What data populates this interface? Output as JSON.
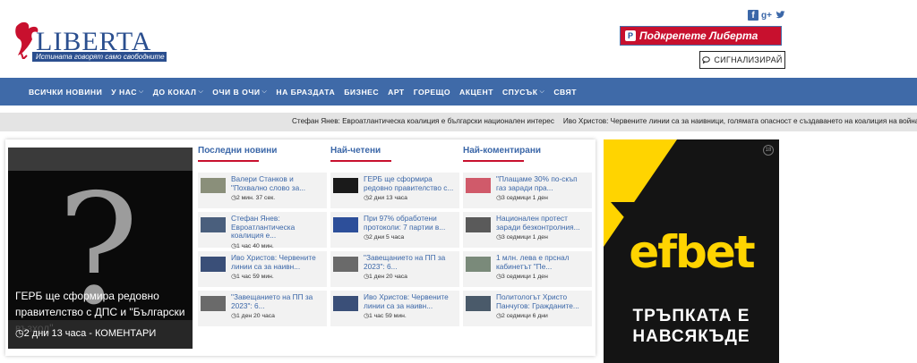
{
  "header": {
    "logo_text": "LIBERTA",
    "tagline": "Истината говорят само свободните",
    "support_label": "Подкрепете Либерта",
    "signal_label": "СИГНАЛИЗИРАЙ",
    "social": [
      "f",
      "g+",
      "t"
    ]
  },
  "nav": {
    "items": [
      {
        "label": "ВСИЧКИ НОВИНИ",
        "dropdown": false
      },
      {
        "label": "У НАС",
        "dropdown": true
      },
      {
        "label": "ДО КОКАЛ",
        "dropdown": true
      },
      {
        "label": "ОЧИ В ОЧИ",
        "dropdown": true
      },
      {
        "label": "НА БРАЗДАТА",
        "dropdown": false
      },
      {
        "label": "БИЗНЕС",
        "dropdown": false
      },
      {
        "label": "АРТ",
        "dropdown": false
      },
      {
        "label": "ГОРЕЩО",
        "dropdown": false
      },
      {
        "label": "АКЦЕНТ",
        "dropdown": false
      },
      {
        "label": "СПУСЪК",
        "dropdown": true
      },
      {
        "label": "СВЯТ",
        "dropdown": false
      }
    ]
  },
  "ticker": {
    "items": [
      "Стефан Янев: Евроатлантическа коалиция е български национален интерес",
      "Иво Христов: Червените линии са за наивници, голямата опасност е създаването на коалиция на войната"
    ]
  },
  "feature": {
    "title": "ГЕРБ ще сформира редовно правителство с ДПС и \"Български възход\"",
    "meta": "2 дни 13 часа - КОМЕНТАРИ"
  },
  "columns": [
    {
      "heading": "Последни новини",
      "items": [
        {
          "title": "Валери Станков и \"Похвално слово за...",
          "meta": "2 мин. 37 сек.",
          "thumb": "#8a8f7a"
        },
        {
          "title": "Стефан Янев: Евроатлантическа коалиция е...",
          "meta": "1 час 40 мин.",
          "thumb": "#4a5f7d"
        },
        {
          "title": "Иво Христов: Червените линии са за наивн...",
          "meta": "1 час 59 мин.",
          "thumb": "#3a4f78"
        },
        {
          "title": "\"Завещанието на ПП за 2023\": 6...",
          "meta": "1 ден 20 часа",
          "thumb": "#6a6a6a"
        }
      ]
    },
    {
      "heading": "Най-четени",
      "items": [
        {
          "title": "ГЕРБ ще сформира редовно правителство с...",
          "meta": "2 дни 13 часа",
          "thumb": "#1a1a1a"
        },
        {
          "title": "При 97% обработени протоколи: 7 партии в...",
          "meta": "2 дни 5 часа",
          "thumb": "#2d4f9a"
        },
        {
          "title": "\"Завещанието на ПП за 2023\": 6...",
          "meta": "1 ден 20 часа",
          "thumb": "#6a6a6a"
        },
        {
          "title": "Иво Христов: Червените линии са за наивн...",
          "meta": "1 час 59 мин.",
          "thumb": "#3a4f78"
        }
      ]
    },
    {
      "heading": "Най-коментирани",
      "items": [
        {
          "title": "\"Плащаме 30% по-скъп газ заради пра...",
          "meta": "3 седмици 1 ден",
          "thumb": "#d05a6a"
        },
        {
          "title": "Национален протест заради безконтролния...",
          "meta": "3 седмици 1 ден",
          "thumb": "#5a5a5a"
        },
        {
          "title": "1 млн. лева е прснал кабинетът \"Пе...",
          "meta": "3 седмици 1 ден",
          "thumb": "#7a8a7a"
        },
        {
          "title": "Политологът Христо Панчугов: Гражданите...",
          "meta": "2 седмици 6 дни",
          "thumb": "#4a5a6a"
        }
      ]
    }
  ],
  "ad": {
    "age_badge": "18",
    "brand": "efbet",
    "slogan": "ТРЪПКАТА Е НАВСЯКЪДЕ",
    "colors": {
      "background": "#141414",
      "accent": "#ffd400"
    }
  },
  "colors": {
    "brand_blue": "#3f6aa8",
    "accent_red": "#c8102e"
  }
}
